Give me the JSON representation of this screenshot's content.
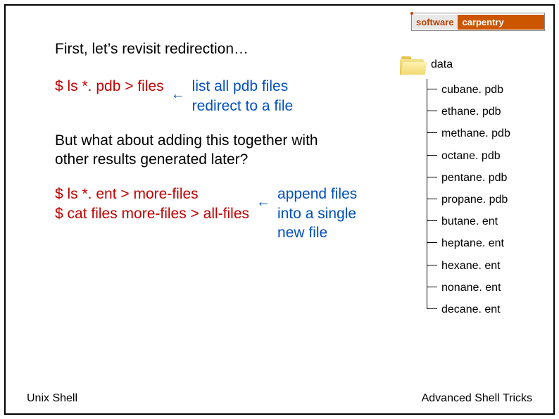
{
  "logo": {
    "left": "software",
    "right": "carpentry"
  },
  "heading": "First, let’s revisit redirection…",
  "cmd1": "$ ls *. pdb > files",
  "anno1_line1": "list all pdb files",
  "anno1_line2": "redirect to a file",
  "question_line1": "But what about adding this together with",
  "question_line2": "other results generated later?",
  "cmd2_line1": "$ ls *. ent > more-files",
  "cmd2_line2": "$ cat files more-files > all-files",
  "anno2_line1": "append files",
  "anno2_line2": "into a single",
  "anno2_line3": "new file",
  "folder_label": "data",
  "files": [
    "cubane. pdb",
    "ethane. pdb",
    "methane. pdb",
    "octane. pdb",
    "pentane. pdb",
    "propane. pdb",
    "butane. ent",
    "heptane. ent",
    "hexane. ent",
    "nonane. ent",
    "decane. ent"
  ],
  "footer_left": "Unix Shell",
  "footer_right": "Advanced Shell Tricks"
}
